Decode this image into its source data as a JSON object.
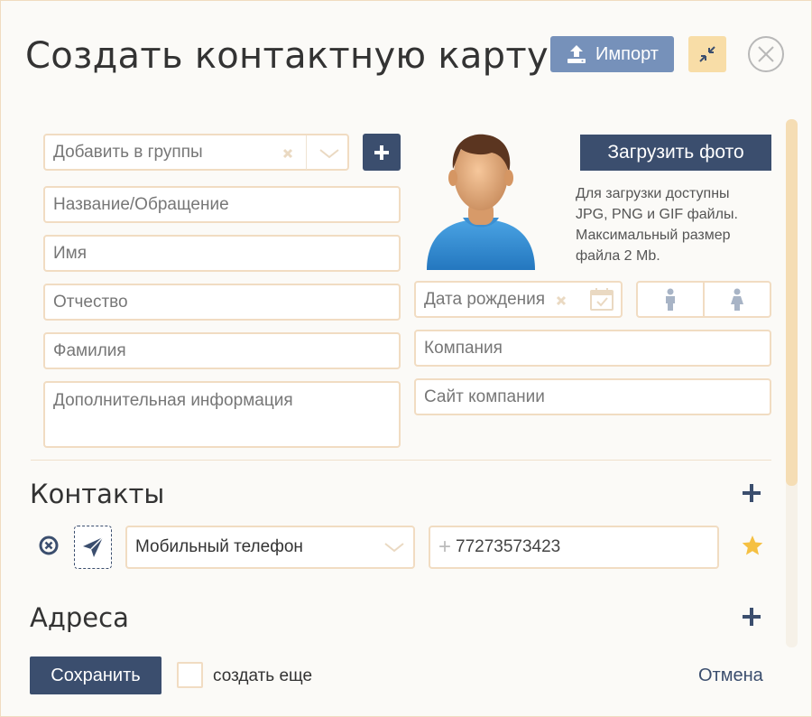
{
  "dialog": {
    "title": "Создать контактную карту",
    "import_label": "Импорт"
  },
  "form": {
    "groups_placeholder": "Добавить в группы",
    "title_placeholder": "Название/Обращение",
    "first_name_placeholder": "Имя",
    "middle_name_placeholder": "Отчество",
    "last_name_placeholder": "Фамилия",
    "extra_info_placeholder": "Дополнительная информация",
    "birthday_placeholder": "Дата рождения",
    "company_placeholder": "Компания",
    "company_site_placeholder": "Сайт компании"
  },
  "photo": {
    "upload_label": "Загрузить фото",
    "note": "Для загрузки доступны JPG, PNG и GIF файлы. Максимальный размер файла 2 Mb."
  },
  "contacts": {
    "heading": "Контакты",
    "type_value": "Мобильный телефон",
    "phone_value": "77273573423"
  },
  "addresses": {
    "heading": "Адреса"
  },
  "footer": {
    "save_label": "Сохранить",
    "create_more_label": "создать еще",
    "cancel_label": "Отмена"
  },
  "colors": {
    "primary": "#3b4e6e",
    "import": "#7691ba",
    "collapse": "#f8dda7",
    "border": "#f1dcc2",
    "required": "#ee1111",
    "star": "#f5c042"
  },
  "icons": [
    "upload-icon",
    "collapse-icon",
    "close-icon",
    "clear-icon",
    "chevron-down-icon",
    "plus-icon",
    "calendar-icon",
    "male-icon",
    "female-icon",
    "remove-icon",
    "send-icon",
    "star-icon"
  ]
}
